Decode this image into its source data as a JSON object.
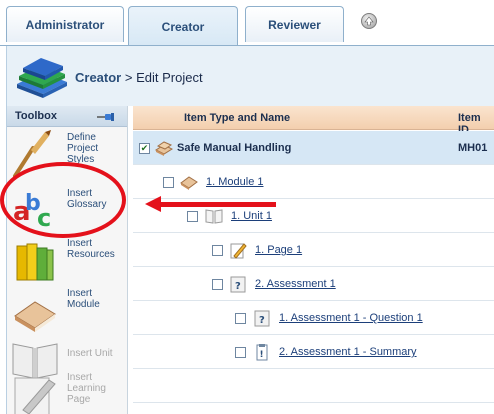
{
  "tabs": [
    {
      "label": "Administrator"
    },
    {
      "label": "Creator",
      "active": true
    },
    {
      "label": "Reviewer"
    }
  ],
  "up_icon": "up-arrow-circle-icon",
  "breadcrumb": {
    "section": "Creator",
    "separator": ">",
    "page": "Edit Project"
  },
  "toolbox": {
    "title": "Toolbox",
    "items": [
      {
        "label": "Define Project Styles",
        "icon": "paintbrush-icon",
        "enabled": true
      },
      {
        "label": "Insert Glossary",
        "icon": "abc-glossary-icon",
        "enabled": true
      },
      {
        "label": "Insert Resources",
        "icon": "folders-icon",
        "enabled": true
      },
      {
        "label": "Insert Module",
        "icon": "book-closed-icon",
        "enabled": true
      },
      {
        "label": "Insert Unit",
        "icon": "book-open-icon",
        "enabled": false
      },
      {
        "label": "Insert Learning Page",
        "icon": "pencil-page-icon",
        "enabled": false
      }
    ]
  },
  "grid": {
    "columns": [
      "Item Type and Name",
      "Item ID"
    ],
    "rows": [
      {
        "name": "Safe Manual Handling",
        "id": "MH01",
        "checked": true,
        "icon": "books-stack-icon",
        "level": 0
      },
      {
        "name": "1. Module 1",
        "checked": false,
        "icon": "book-closed-icon",
        "level": 1
      },
      {
        "name": "1. Unit 1",
        "checked": false,
        "icon": "book-open-icon",
        "level": 2
      },
      {
        "name": "1. Page 1",
        "checked": false,
        "icon": "pencil-page-icon",
        "level": 3
      },
      {
        "name": "2. Assessment 1",
        "checked": false,
        "icon": "question-page-icon",
        "level": 3
      },
      {
        "name": "1. Assessment 1 - Question 1",
        "checked": false,
        "icon": "question-page-icon",
        "level": 4
      },
      {
        "name": "2. Assessment 1 - Summary",
        "checked": false,
        "icon": "summary-page-icon",
        "level": 4
      }
    ]
  },
  "annotation": {
    "color": "#e4111b"
  }
}
